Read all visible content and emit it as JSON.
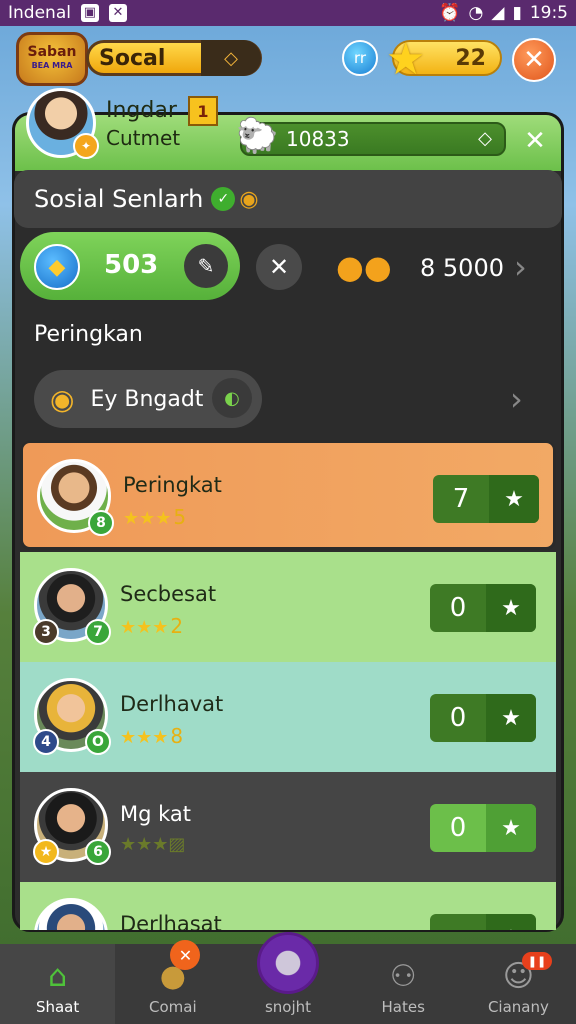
{
  "status_bar": {
    "carrier": "Indenal",
    "time": "19:5"
  },
  "hud": {
    "logo_line1": "Saban",
    "logo_line2": "BEA MRA",
    "currency_label": "Socal",
    "blue_icon_text": "rr",
    "star_count": "22"
  },
  "profile": {
    "name": "Ingdar",
    "level": "1",
    "subtitle": "Cutmet",
    "points": "10833"
  },
  "section": {
    "title": "Sosial Senlarh"
  },
  "stats": {
    "shield_value": "503",
    "coin_value": "8 5000"
  },
  "ranking": {
    "title": "Peringkan",
    "filter_label": "Ey Bngadt"
  },
  "leaderboard": [
    {
      "name": "Peringkat",
      "stars_value": "5",
      "score": "7",
      "badge1": "",
      "badge2": "8"
    },
    {
      "name": "Secbesat",
      "stars_value": "2",
      "score": "0",
      "badge1": "3",
      "badge2": "7"
    },
    {
      "name": "Derlhavat",
      "stars_value": "8",
      "score": "0",
      "badge1": "4",
      "badge2": "O"
    },
    {
      "name": "Mg kat",
      "stars_value": "",
      "score": "0",
      "badge1": "",
      "badge2": "6"
    },
    {
      "name": "Derlhasat",
      "stars_value": "",
      "score": "",
      "badge1": "",
      "badge2": ""
    }
  ],
  "nav": [
    {
      "label": "Shaat",
      "icon": "home-icon"
    },
    {
      "label": "Comai",
      "icon": "coin-icon"
    },
    {
      "label": "snojht",
      "icon": "profile-icon"
    },
    {
      "label": "Hates",
      "icon": "people-icon"
    },
    {
      "label": "Cianany",
      "icon": "user-icon"
    }
  ]
}
